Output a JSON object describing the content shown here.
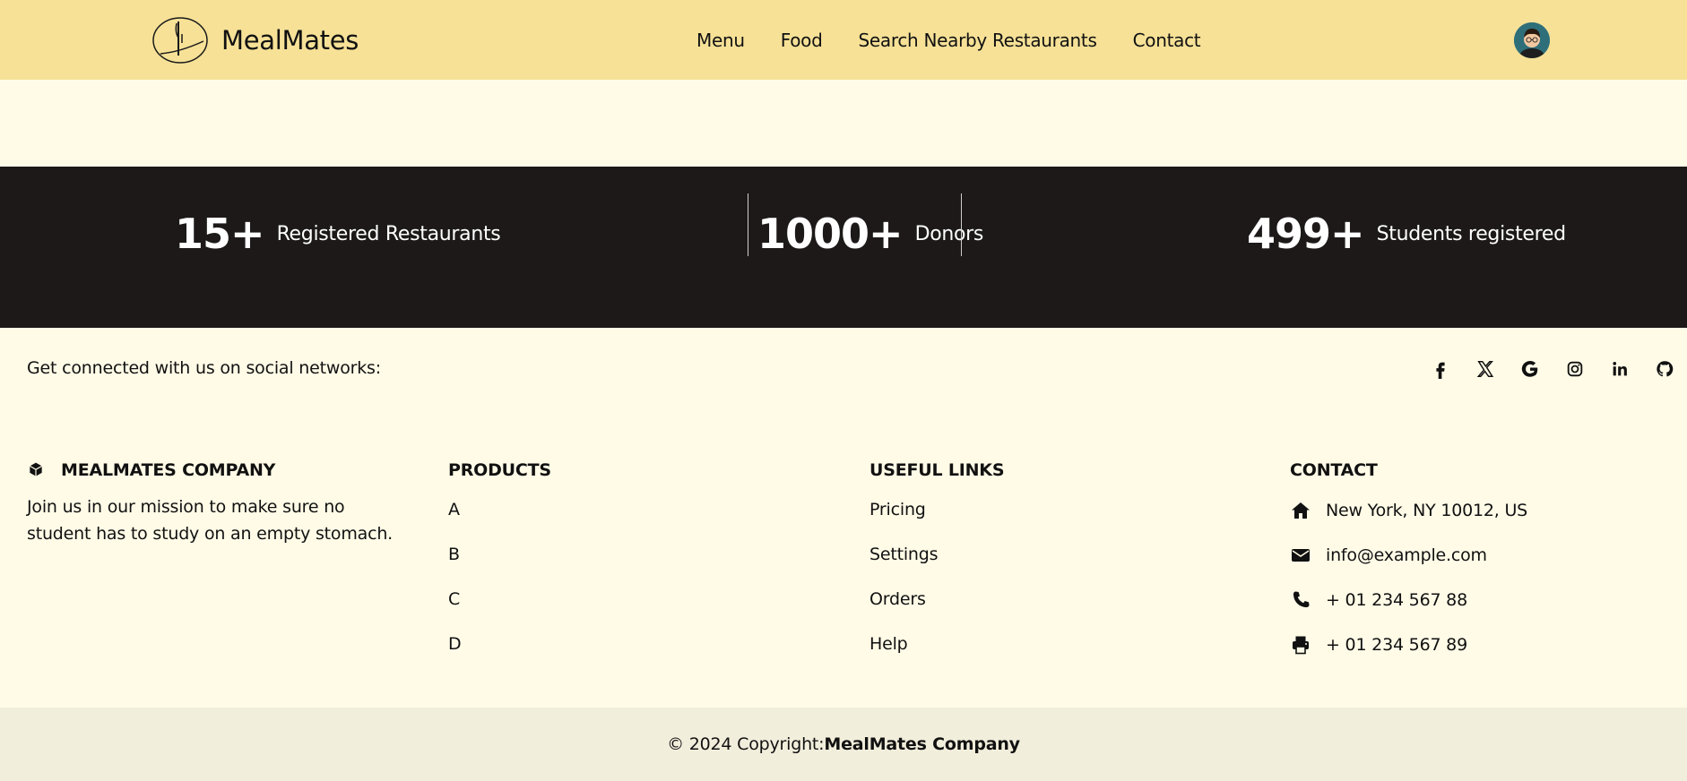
{
  "navbar": {
    "brand_name": "MealMates",
    "links": [
      {
        "label": "Menu"
      },
      {
        "label": "Food"
      },
      {
        "label": "Search Nearby Restaurants"
      },
      {
        "label": "Contact"
      }
    ]
  },
  "stats": [
    {
      "number": "15+",
      "label": "Registered Restaurants"
    },
    {
      "number": "1000+",
      "label": "Donors"
    },
    {
      "number": "499+",
      "label": "Students registered"
    }
  ],
  "social": {
    "text": "Get connected with us on social networks:",
    "icons": [
      "facebook-icon",
      "x-icon",
      "google-icon",
      "instagram-icon",
      "linkedin-icon",
      "github-icon"
    ]
  },
  "footer": {
    "company": {
      "title": "MEALMATES COMPANY",
      "text": "Join us in our mission to make sure no student has to study on an empty stomach."
    },
    "products": {
      "title": "PRODUCTS",
      "items": [
        "A",
        "B",
        "C",
        "D"
      ]
    },
    "useful_links": {
      "title": "USEFUL LINKS",
      "items": [
        "Pricing",
        "Settings",
        "Orders",
        "Help"
      ]
    },
    "contact": {
      "title": "CONTACT",
      "address": "New York, NY 10012, US",
      "email": "info@example.com",
      "phone": "+ 01 234 567 88",
      "fax": "+ 01 234 567 89"
    }
  },
  "copyright": {
    "prefix": "© 2024 Copyright:",
    "company": "MealMates Company"
  },
  "colors": {
    "navbar_bg": "#f6e197",
    "page_bg": "#fffbe7",
    "stats_bg": "#1d1919",
    "copyright_bg": "#f2eedc"
  }
}
